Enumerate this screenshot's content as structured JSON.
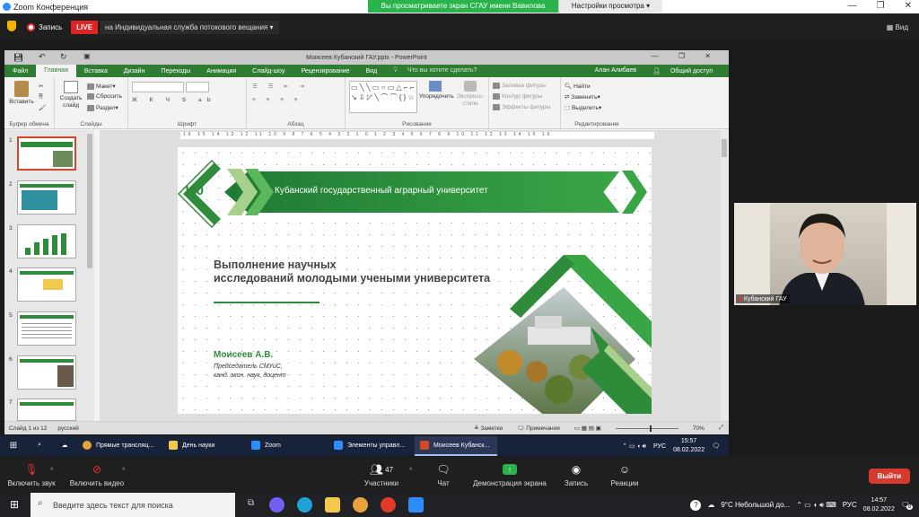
{
  "zoom": {
    "window_title": "Zoom Конференция",
    "share_banner": "Вы просматриваете экран СГАУ имени Вавилова",
    "view_options": "Настройки просмотра",
    "record_label": "Запись",
    "live_label": "LIVE",
    "stream_label": "на Индивидуальная служба потокового вещания",
    "view_label": "Вид",
    "participant_name": "Кубанский ГАУ",
    "participants_count": "47",
    "controls": [
      {
        "label": "Включить звук",
        "icon": "mic-off-icon"
      },
      {
        "label": "Включить видео",
        "icon": "video-off-icon"
      },
      {
        "label": "Участники",
        "icon": "participants-icon"
      },
      {
        "label": "Чат",
        "icon": "chat-icon"
      },
      {
        "label": "Демонстрация экрана",
        "icon": "share-screen-icon"
      },
      {
        "label": "Запись",
        "icon": "record-icon"
      },
      {
        "label": "Реакции",
        "icon": "reactions-icon"
      }
    ],
    "exit_label": "Выйти"
  },
  "ppt": {
    "title": "Моисеев Кубанский ГАУ.pptx - PowerPoint",
    "menu": [
      "Файл",
      "Главная",
      "Вставка",
      "Дизайн",
      "Переходы",
      "Анимация",
      "Слайд-шоу",
      "Рецензирование",
      "Вид"
    ],
    "tell_me": "Что вы хотите сделать?",
    "user": "Алан Алибаев",
    "share": "Общий доступ",
    "ribbon": {
      "paste": "Вставить",
      "clipboard": "Буфер обмена",
      "new_slide": "Создать слайд",
      "layout": "Макет",
      "reset": "Сбросить",
      "section": "Раздел",
      "slides": "Слайды",
      "font": "Шрифт",
      "paragraph": "Абзац",
      "arrange": "Упорядочить",
      "quick_styles": "Экспресс-стили",
      "shape_fill": "Заливка фигуры",
      "shape_outline": "Контур фигуры",
      "shape_effects": "Эффекты фигуры",
      "drawing": "Рисование",
      "find": "Найти",
      "replace": "Заменить",
      "select": "Выделить",
      "editing": "Редактирование"
    },
    "ruler": "16 15 14 13 12 11 10 9 8 7 6 5 4 3 2 1 0 1 2 3 4 5 6 7 8 9 10 11 12 13 14 15 16",
    "thumb_numbers": [
      "1",
      "2",
      "3",
      "4",
      "5",
      "6",
      "7"
    ],
    "status": {
      "slide_of": "Слайд 1 из 12",
      "language": "русский",
      "notes": "Заметки",
      "comments": "Примечания",
      "zoom": "70%"
    },
    "slide": {
      "logo_text": "100",
      "university": "Кубанский государственный аграрный университет",
      "title_line1": "Выполнение научных",
      "title_line2": "исследований молодыми учеными университета",
      "author": "Моисеев А.В.",
      "role_line1": "Председатель СМУиС,",
      "role_line2": "канд. экон. наук, доцент"
    }
  },
  "remote_taskbar": {
    "apps": [
      {
        "label": "Прямые трансляц...",
        "color": "#e9a23b"
      },
      {
        "label": "День науки",
        "color": "#f2c94c"
      },
      {
        "label": "Zoom",
        "color": "#2d8cff"
      },
      {
        "label": "Элементы управл...",
        "color": "#2d8cff"
      },
      {
        "label": "Моисеев Кубанск...",
        "color": "#d24726"
      }
    ],
    "lang": "РУС",
    "time": "15:57",
    "date": "08.02.2022"
  },
  "taskbar": {
    "search_placeholder": "Введите здесь текст для поиска",
    "weather": "9°C  Небольшой до...",
    "lang": "РУС",
    "time": "14:57",
    "date": "08.02.2022",
    "notif_count": "8"
  }
}
